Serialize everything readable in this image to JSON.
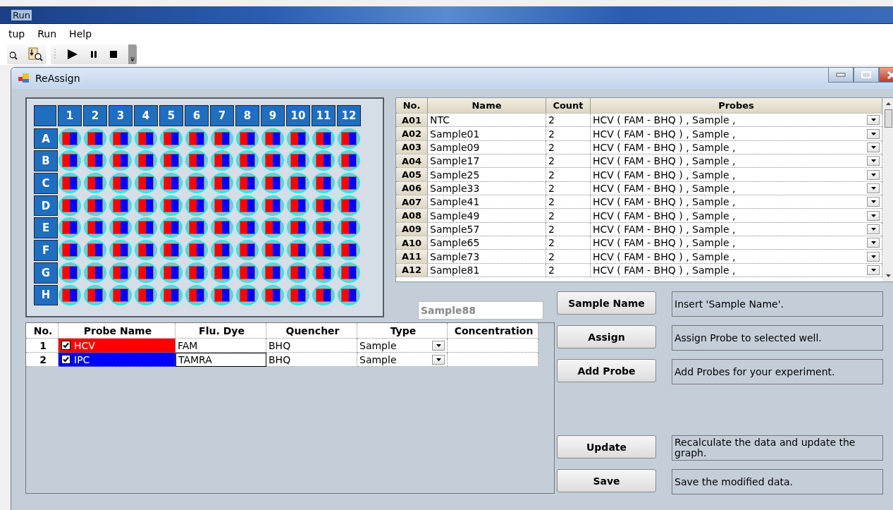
{
  "app": {
    "title": "Run",
    "menu": [
      {
        "label": "tup"
      },
      {
        "label": "Run"
      },
      {
        "label": "Help"
      }
    ]
  },
  "dialog": {
    "title": "ReAssign"
  },
  "plate": {
    "columns": [
      "1",
      "2",
      "3",
      "4",
      "5",
      "6",
      "7",
      "8",
      "9",
      "10",
      "11",
      "12"
    ],
    "rows": [
      "A",
      "B",
      "C",
      "D",
      "E",
      "F",
      "G",
      "H"
    ]
  },
  "samples": {
    "columns": [
      "No.",
      "Name",
      "Count",
      "Probes"
    ],
    "rows": [
      {
        "no": "A01",
        "name": "NTC",
        "count": "2",
        "probes": "HCV ( FAM - BHQ ) , Sample ,"
      },
      {
        "no": "A02",
        "name": "Sample01",
        "count": "2",
        "probes": "HCV ( FAM - BHQ ) , Sample ,"
      },
      {
        "no": "A03",
        "name": "Sample09",
        "count": "2",
        "probes": "HCV ( FAM - BHQ ) , Sample ,"
      },
      {
        "no": "A04",
        "name": "Sample17",
        "count": "2",
        "probes": "HCV ( FAM - BHQ ) , Sample ,"
      },
      {
        "no": "A05",
        "name": "Sample25",
        "count": "2",
        "probes": "HCV ( FAM - BHQ ) , Sample ,"
      },
      {
        "no": "A06",
        "name": "Sample33",
        "count": "2",
        "probes": "HCV ( FAM - BHQ ) , Sample ,"
      },
      {
        "no": "A07",
        "name": "Sample41",
        "count": "2",
        "probes": "HCV ( FAM - BHQ ) , Sample ,"
      },
      {
        "no": "A08",
        "name": "Sample49",
        "count": "2",
        "probes": "HCV ( FAM - BHQ ) , Sample ,"
      },
      {
        "no": "A09",
        "name": "Sample57",
        "count": "2",
        "probes": "HCV ( FAM - BHQ ) , Sample ,"
      },
      {
        "no": "A10",
        "name": "Sample65",
        "count": "2",
        "probes": "HCV ( FAM - BHQ ) , Sample ,"
      },
      {
        "no": "A11",
        "name": "Sample73",
        "count": "2",
        "probes": "HCV ( FAM - BHQ ) , Sample ,"
      },
      {
        "no": "A12",
        "name": "Sample81",
        "count": "2",
        "probes": "HCV ( FAM - BHQ ) , Sample ,"
      }
    ]
  },
  "sample_name_field": {
    "value": "Sample88"
  },
  "probes": {
    "columns": [
      "No.",
      "Probe Name",
      "Flu. Dye",
      "Quencher",
      "Type",
      "Concentration"
    ],
    "rows": [
      {
        "no": "1",
        "checked": true,
        "name": "HCV",
        "color": "#ff0000",
        "dye": "FAM",
        "quencher": "BHQ",
        "type": "Sample",
        "dye_focused": false
      },
      {
        "no": "2",
        "checked": true,
        "name": "IPC",
        "color": "#0000ff",
        "dye": "TAMRA",
        "quencher": "BHQ",
        "type": "Sample",
        "dye_focused": true
      }
    ]
  },
  "actions": {
    "upper": [
      {
        "label": "Sample Name",
        "hint": "Insert 'Sample Name'."
      },
      {
        "label": "Assign",
        "hint": "Assign Probe to selected well."
      },
      {
        "label": "Add Probe",
        "hint": "Add Probes for your experiment."
      }
    ],
    "lower": [
      {
        "label": "Update",
        "hint": "Recalculate the data and update the graph."
      },
      {
        "label": "Save",
        "hint": "Save the modified data."
      }
    ]
  }
}
